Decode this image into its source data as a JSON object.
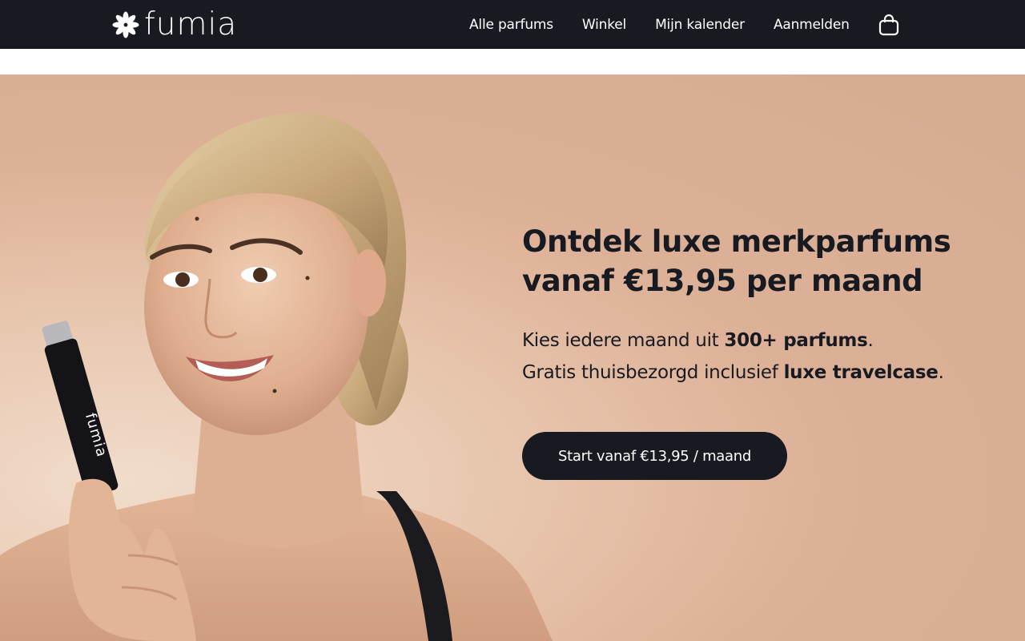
{
  "nav": {
    "logo_text": "fumia",
    "logo_icon": "flower-icon",
    "links": [
      "Alle parfums",
      "Winkel",
      "Mijn kalender",
      "Aanmelden"
    ],
    "cart_icon": "shopping-bag-icon"
  },
  "hero": {
    "title": "Ontdek luxe merkparfums vanaf €13,95 per maand",
    "line1_pre": "Kies iedere maand uit ",
    "line1_bold": "300+ parfums",
    "line1_post": ".",
    "line2_pre": "Gratis thuisbezorgd inclusief ",
    "line2_bold": "luxe travelcase",
    "line2_post": ".",
    "cta_label": "Start vanaf €13,95 / maand",
    "bottle_brand": "fumia"
  },
  "colors": {
    "nav_bg": "#181a21",
    "hero_bg": "#d6ab92",
    "cta_bg": "#181a21",
    "text": "#181a21"
  }
}
